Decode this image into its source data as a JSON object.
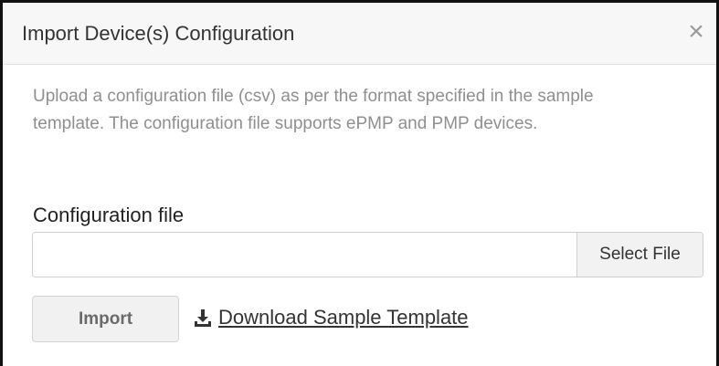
{
  "dialog": {
    "title": "Import Device(s) Configuration",
    "close_label": "×",
    "description": "Upload a configuration file (csv) as per the format specified in the sample template. The configuration file supports ePMP and PMP devices.",
    "field_label": "Configuration file",
    "file_input_value": "",
    "select_file_label": "Select File",
    "import_label": "Import",
    "download_label": "Download Sample Template",
    "download_icon": "download-icon"
  }
}
